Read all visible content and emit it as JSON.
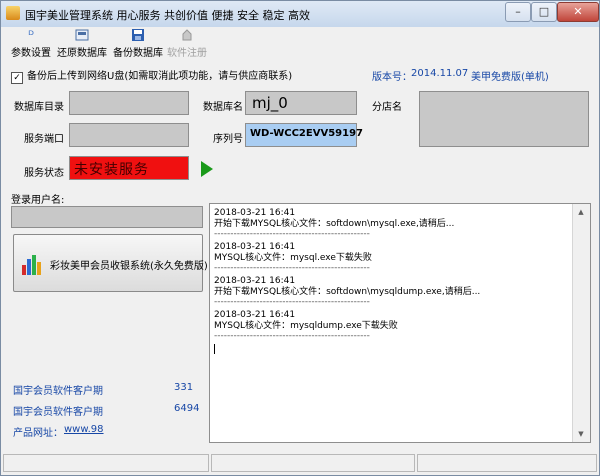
{
  "window": {
    "title": "国宇美业管理系统  用心服务  共创价值  便捷 安全 稳定 高效"
  },
  "toolbar": {
    "items": [
      {
        "label": "参数设置",
        "icon": "paperclip-icon"
      },
      {
        "label": "还原数据库",
        "icon": "restore-icon"
      },
      {
        "label": "备份数据库",
        "icon": "save-icon"
      },
      {
        "label": "软件注册",
        "icon": "register-icon"
      }
    ]
  },
  "backup": {
    "checked": true,
    "label": "备份后上传到网络U盘(如需取消此项功能，请与供应商联系)"
  },
  "version": {
    "label": "版本号：",
    "value": "2014.11.07",
    "edition": "美甲免费版(单机)"
  },
  "form": {
    "db_dir_label": "数据库目录",
    "db_dir_value": "",
    "db_name_label": "数据库名",
    "db_name_value": "mj_0",
    "branch_label": "分店名",
    "branch_value": "",
    "port_label": "服务端口",
    "port_value": "",
    "serial_label": "序列号",
    "serial_value": "WD-WCC2EVV59197",
    "service_label": "服务状态",
    "service_value": "未安装服务"
  },
  "login": {
    "label": "登录用户名:",
    "value": ""
  },
  "launch_button": {
    "label": "彩妆美甲会员收银系统(永久免费版)"
  },
  "log": [
    {
      "time": "2018-03-21 16:41",
      "message": "开始下载MYSQL核心文件：softdown\\mysql.exe,请稍后..."
    },
    {
      "time": "2018-03-21 16:41",
      "message": "MYSQL核心文件：mysql.exe下载失败"
    },
    {
      "time": "2018-03-21 16:41",
      "message": "开始下载MYSQL核心文件：softdown\\mysqldump.exe,请稍后..."
    },
    {
      "time": "2018-03-21 16:41",
      "message": "MYSQL核心文件：mysqldump.exe下载失败"
    }
  ],
  "log_divider": "------------------------------------------------",
  "stats": [
    {
      "label": "国宇会员软件客户期",
      "value": "331"
    },
    {
      "label": "国宇会员软件客户期",
      "value": "6494"
    }
  ],
  "product_site": {
    "label": "产品网址：",
    "link": "www.98"
  },
  "colors": {
    "version_blue": "#1747a6",
    "service_red": "#f01010",
    "serial_blue": "#a9cdf2"
  }
}
